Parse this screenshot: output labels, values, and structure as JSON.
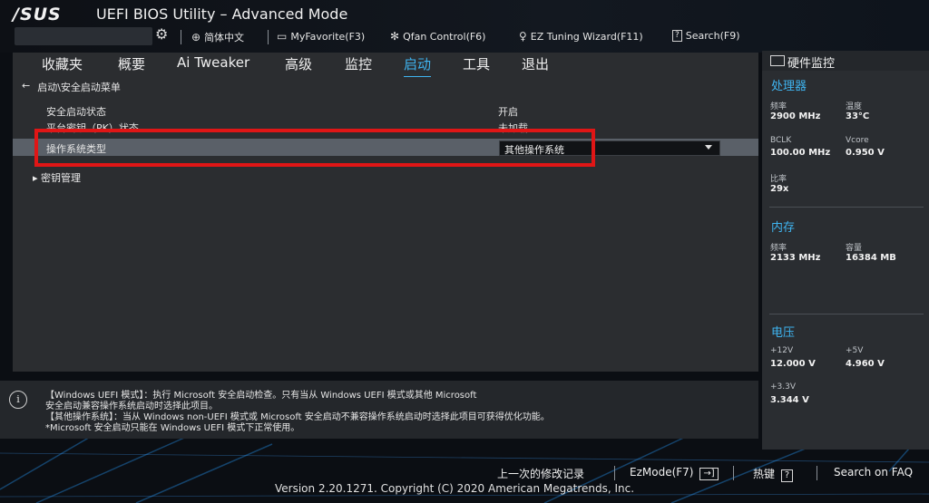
{
  "header": {
    "logo": "/SUS",
    "title": "UEFI BIOS Utility – Advanced Mode",
    "tools": [
      {
        "label": "简体中文",
        "icon": "globe-icon"
      },
      {
        "label": "MyFavorite(F3)",
        "icon": "favorite-icon"
      },
      {
        "label": "Qfan Control(F6)",
        "icon": "fan-icon"
      },
      {
        "label": "EZ Tuning Wizard(F11)",
        "icon": "bulb-icon"
      },
      {
        "label": "Search(F9)",
        "icon": "search-icon"
      }
    ]
  },
  "tabs": [
    "收藏夹",
    "概要",
    "Ai Tweaker",
    "高级",
    "监控",
    "启动",
    "工具",
    "退出"
  ],
  "active_tab": "启动",
  "breadcrumb": "启动\\安全启动菜单",
  "settings": [
    {
      "label": "安全启动状态",
      "value": "开启"
    },
    {
      "label": "平台密钥（PK）状态",
      "value": "未加载"
    }
  ],
  "selected_setting": {
    "label": "操作系统类型",
    "value": "其他操作系统"
  },
  "submenu": "密钥管理",
  "help": [
    "【Windows UEFI 模式】：执行 Microsoft 安全启动检查。只有当从 Windows UEFI 模式或其他 Microsoft",
    "安全启动兼容操作系统启动时选择此项目。",
    "【其他操作系统】：当从 Windows non-UEFI 模式或 Microsoft 安全启动不兼容操作系统启动时选择此项目可获得优化功能。",
    "*Microsoft 安全启动只能在 Windows UEFI 模式下正常使用。"
  ],
  "hw_monitor": {
    "title": "硬件监控",
    "cpu": {
      "section": "处理器",
      "freq_label": "频率",
      "freq": "2900 MHz",
      "temp_label": "温度",
      "temp": "33°C",
      "bclk_label": "BCLK",
      "bclk": "100.00 MHz",
      "vcore_label": "Vcore",
      "vcore": "0.950 V",
      "ratio_label": "比率",
      "ratio": "29x"
    },
    "memory": {
      "section": "内存",
      "freq_label": "频率",
      "freq": "2133 MHz",
      "cap_label": "容量",
      "cap": "16384 MB"
    },
    "voltage": {
      "section": "电压",
      "v12_label": "+12V",
      "v12": "12.000 V",
      "v5_label": "+5V",
      "v5": "4.960 V",
      "v33_label": "+3.3V",
      "v33": "3.344 V"
    }
  },
  "bottom": {
    "last_changes": "上一次的修改记录",
    "ezmode": "EzMode(F7)",
    "ezmode_icon": "exit-arrow-icon",
    "hotkeys": "热键",
    "hotkeys_key": "?",
    "faq": "Search on FAQ",
    "version": "Version 2.20.1271. Copyright (C) 2020 American Megatrends, Inc."
  }
}
